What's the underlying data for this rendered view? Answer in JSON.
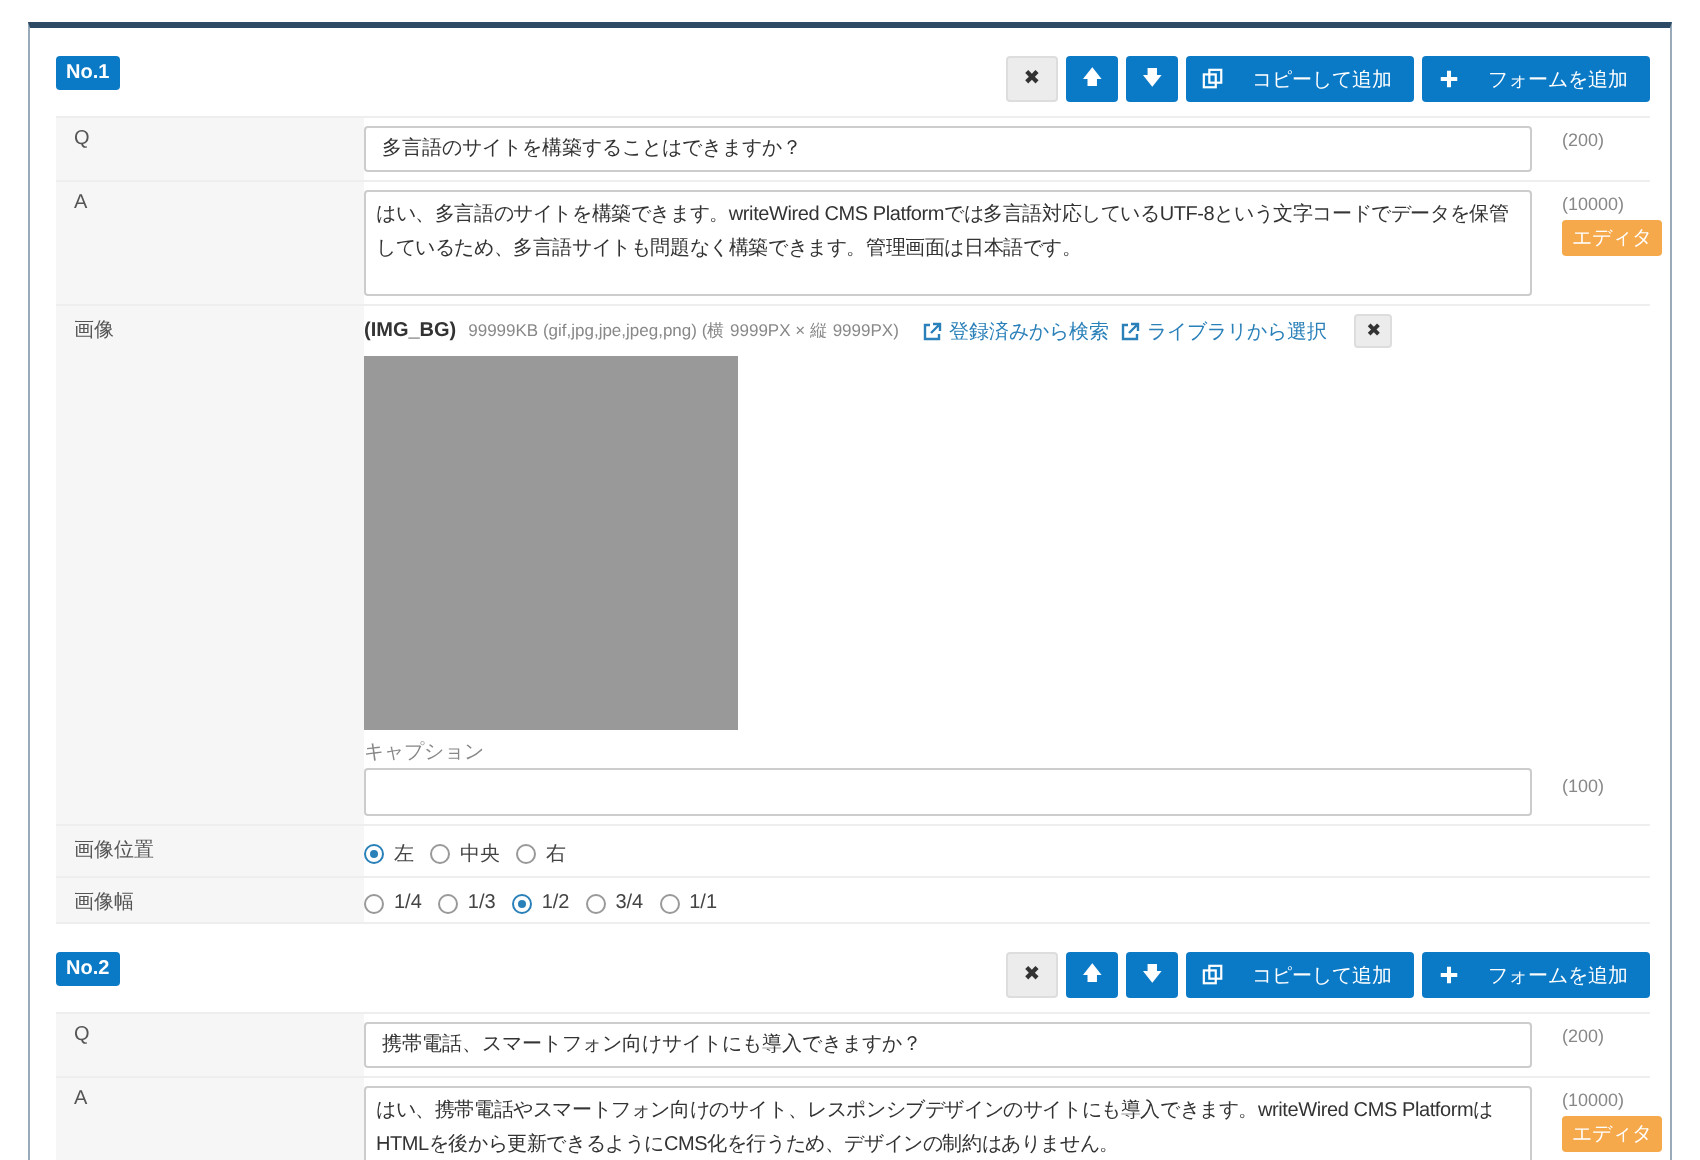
{
  "entries": [
    {
      "number": "No.1",
      "buttons": [
        {
          "kind": "delete",
          "label": "✖"
        },
        {
          "kind": "up",
          "label": "🡅"
        },
        {
          "kind": "down",
          "label": "🡇"
        },
        {
          "kind": "copy",
          "label": "コピーして追加"
        },
        {
          "kind": "add",
          "label": "フォームを追加"
        }
      ],
      "fields": [
        {
          "kind": "input",
          "label": "Q",
          "value": "多言語のサイトを構築することはできますか？",
          "count": "(200)"
        },
        {
          "kind": "textarea",
          "label": "A",
          "value": "はい、多言語のサイトを構築できます。writeWired CMS Platformでは多言語対応しているUTF-8という文字コードでデータを保管しているため、多言語サイトも問題なく構築できます。管理画面は日本語です。",
          "count": "(10000)",
          "badge": "エディタ"
        },
        {
          "kind": "image",
          "label": "画像",
          "code": "(IMG_BG)",
          "spec": "99999KB (gif,jpg,jpe,jpeg,png) (横 9999PX × 縦 9999PX)",
          "links": [
            "登録済みから検索",
            "ライブラリから選択"
          ],
          "remove": "✖",
          "caption_label": "キャプション",
          "count": "(100)"
        },
        {
          "kind": "radio",
          "label": "画像位置",
          "options": [
            {
              "label": "左",
              "selected": true
            },
            {
              "label": "中央",
              "selected": false
            },
            {
              "label": "右",
              "selected": false
            }
          ]
        },
        {
          "kind": "radio",
          "label": "画像幅",
          "options": [
            {
              "label": "1/4",
              "selected": false
            },
            {
              "label": "1/3",
              "selected": false
            },
            {
              "label": "1/2",
              "selected": true
            },
            {
              "label": "3/4",
              "selected": false
            },
            {
              "label": "1/1",
              "selected": false
            }
          ]
        }
      ]
    },
    {
      "number": "No.2",
      "buttons": [
        {
          "kind": "delete",
          "label": "✖"
        },
        {
          "kind": "up",
          "label": "🡅"
        },
        {
          "kind": "down",
          "label": "🡇"
        },
        {
          "kind": "copy",
          "label": "コピーして追加"
        },
        {
          "kind": "add",
          "label": "フォームを追加"
        }
      ],
      "fields": [
        {
          "kind": "input",
          "label": "Q",
          "value": "携帯電話、スマートフォン向けサイトにも導入できますか？",
          "count": "(200)"
        },
        {
          "kind": "textarea",
          "label": "A",
          "value": "はい、携帯電話やスマートフォン向けのサイト、レスポンシブデザインのサイトにも導入できます。writeWired CMS PlatformはHTMLを後から更新できるようにCMS化を行うため、デザインの制約はありません。",
          "count": "(10000)",
          "badge": "エディタ"
        }
      ]
    }
  ]
}
